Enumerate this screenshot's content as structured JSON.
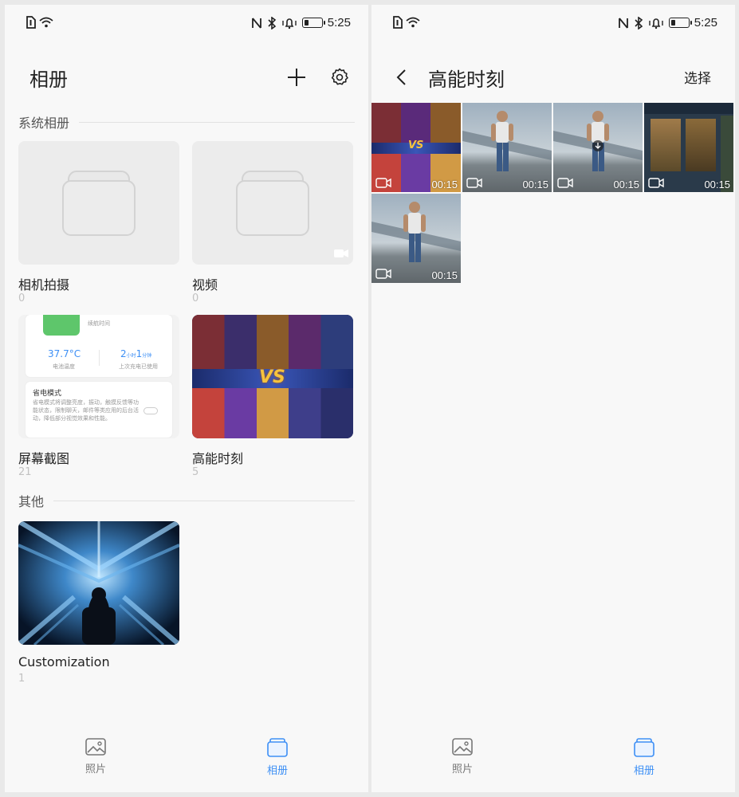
{
  "status_bar": {
    "time": "5:25"
  },
  "left": {
    "title": "相册",
    "sections": {
      "system": "系统相册",
      "other": "其他"
    },
    "albums": [
      {
        "name": "相机拍摄",
        "count": "0"
      },
      {
        "name": "视频",
        "count": "0"
      },
      {
        "name": "屏幕截图",
        "count": "21"
      },
      {
        "name": "高能时刻",
        "count": "5"
      },
      {
        "name": "Customization",
        "count": "1"
      }
    ],
    "screenshot_thumb": {
      "temp_value": "37.7°C",
      "temp_label": "电池温度",
      "time_value_a": "2",
      "time_unit_a": "小时",
      "time_value_b": "1",
      "time_unit_b": "分钟",
      "time_label": "上次充电已使用",
      "standby_label": "续航时间",
      "mode_title": "省电模式",
      "mode_desc": "省电模式将调整亮度，振动，触摸反馈等功能状态，限制聊天，邮件等类应用的后台活动，降低部分视觉效果和性能。"
    }
  },
  "right": {
    "title": "高能时刻",
    "select_label": "选择",
    "videos": [
      {
        "duration": "00:15"
      },
      {
        "duration": "00:15"
      },
      {
        "duration": "00:15"
      },
      {
        "duration": "00:15"
      },
      {
        "duration": "00:15"
      }
    ]
  },
  "nav": {
    "photos_label": "照片",
    "albums_label": "相册"
  },
  "colors": {
    "accent": "#3d8ff5",
    "inactive": "#777777"
  }
}
